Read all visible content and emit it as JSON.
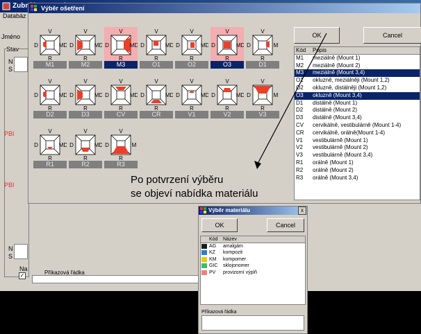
{
  "main_window": {
    "title": "Zubní karta pacienta",
    "menu_first": "Databáz",
    "labels": {
      "name": "Jméno",
      "stav": "Stav",
      "n1": "N",
      "s1": "S",
      "pbi1": "PBI",
      "pbi2": "PBI",
      "n2": "N",
      "s2": "S",
      "na": "Na"
    }
  },
  "treatment_dialog": {
    "title": "Výběr ošetření",
    "ok_label": "OK",
    "cancel_label": "Cancel",
    "list_header": {
      "code": "Kód",
      "description": "Popis"
    },
    "teeth": [
      {
        "code": "M1",
        "selected": false,
        "top": "V",
        "left": "D",
        "right": "MD",
        "bottom": "R",
        "fill": "left-small"
      },
      {
        "code": "M2",
        "selected": false,
        "top": "V",
        "left": "D",
        "right": "MD",
        "bottom": "R",
        "fill": "left"
      },
      {
        "code": "M3",
        "selected": true,
        "top": "V",
        "left": "D",
        "right": "MD",
        "bottom": "R",
        "fill": "right-large"
      },
      {
        "code": "O1",
        "selected": false,
        "top": "V",
        "left": "D",
        "right": "MD",
        "bottom": "R",
        "fill": "center-small"
      },
      {
        "code": "O2",
        "selected": false,
        "top": "V",
        "left": "D",
        "right": "MD",
        "bottom": "R",
        "fill": "center-right"
      },
      {
        "code": "O3",
        "selected": true,
        "top": "V",
        "left": "D",
        "right": "MD",
        "bottom": "R",
        "fill": "center"
      },
      {
        "code": "D1",
        "selected": false,
        "top": "V",
        "left": "D",
        "right": "M",
        "bottom": "R",
        "fill": "right-small"
      },
      {
        "code": "D2",
        "selected": false,
        "top": "V",
        "left": "D",
        "right": "MD",
        "bottom": "R",
        "fill": "left-small"
      },
      {
        "code": "D3",
        "selected": false,
        "top": "V",
        "left": "D",
        "right": "MD",
        "bottom": "R",
        "fill": "left"
      },
      {
        "code": "CV",
        "selected": false,
        "top": "V",
        "left": "D",
        "right": "MD",
        "bottom": "R",
        "fill": "top-small"
      },
      {
        "code": "CR",
        "selected": false,
        "top": "V",
        "left": "D",
        "right": "MD",
        "bottom": "R",
        "fill": "bottom-small"
      },
      {
        "code": "V1",
        "selected": false,
        "top": "V",
        "left": "D",
        "right": "MD",
        "bottom": "R",
        "fill": "top-tiny"
      },
      {
        "code": "V2",
        "selected": false,
        "top": "V",
        "left": "D",
        "right": "MD",
        "bottom": "R",
        "fill": "top"
      },
      {
        "code": "V3",
        "selected": false,
        "top": "V",
        "left": "D",
        "right": "M",
        "bottom": "R",
        "fill": "top-large"
      },
      {
        "code": "R1",
        "selected": false,
        "top": "V",
        "left": "D",
        "right": "MD",
        "bottom": "R",
        "fill": "bottom-tiny"
      },
      {
        "code": "R2",
        "selected": false,
        "top": "V",
        "left": "D",
        "right": "MD",
        "bottom": "R",
        "fill": "bottom"
      },
      {
        "code": "R3",
        "selected": false,
        "top": "V",
        "left": "D",
        "right": "M",
        "bottom": "R",
        "fill": "bottom-large"
      }
    ],
    "list": [
      {
        "code": "M1",
        "description": "meziálně (Mount 1)",
        "selected": false
      },
      {
        "code": "M2",
        "description": "meziálně (Mount 2)",
        "selected": false
      },
      {
        "code": "M3",
        "description": "meziálně (Mount 3,4)",
        "selected": true
      },
      {
        "code": "O1",
        "description": "okluzně, meziálněji (Mount 1,2)",
        "selected": false
      },
      {
        "code": "O2",
        "description": "okluzně, distálněji (Mount 1,2)",
        "selected": false
      },
      {
        "code": "O3",
        "description": "okluzně (Mount 3,4)",
        "selected": true
      },
      {
        "code": "D1",
        "description": "distálně (Mount 1)",
        "selected": false
      },
      {
        "code": "D2",
        "description": "distálně (Mount 2)",
        "selected": false
      },
      {
        "code": "D3",
        "description": "distálně (Mount 3,4)",
        "selected": false
      },
      {
        "code": "CV",
        "description": "cervikálně, vestibulárně (Mount 1-4)",
        "selected": false
      },
      {
        "code": "CR",
        "description": "cervikálně, orálně(Mount 1-4)",
        "selected": false
      },
      {
        "code": "V1",
        "description": "vestibulárně (Mount 1)",
        "selected": false
      },
      {
        "code": "V2",
        "description": "vestibulárně (Mount 2)",
        "selected": false
      },
      {
        "code": "V3",
        "description": "vestibulárně (Mount 3,4)",
        "selected": false
      },
      {
        "code": "R1",
        "description": "orálně (Mount 1)",
        "selected": false
      },
      {
        "code": "R2",
        "description": "orálně (Mount 2)",
        "selected": false
      },
      {
        "code": "R3",
        "description": "orálně (Mount 3,4)",
        "selected": false
      }
    ]
  },
  "annotation": {
    "line1": "Po potvrzení výběru",
    "line2": "se objeví nabídka materiálu"
  },
  "material_dialog": {
    "title": "Výběr materiálu",
    "ok_label": "OK",
    "cancel_label": "Cancel",
    "list_header": {
      "code": "Kód",
      "name": "Název"
    },
    "materials": [
      {
        "code": "AG",
        "name": "amalgám",
        "color": "#1a1a1a"
      },
      {
        "code": "KZ",
        "name": "kompozit",
        "color": "#2a7fd4"
      },
      {
        "code": "KM",
        "name": "kompomer",
        "color": "#e0d000"
      },
      {
        "code": "GIC",
        "name": "sklojonomer",
        "color": "#3cc060"
      },
      {
        "code": "PV",
        "name": "provizorní výplň",
        "color": "#f08080"
      }
    ],
    "command_label": "Příkazová řádka"
  },
  "command_line": {
    "label": "Příkazová řádka"
  },
  "colors": {
    "fill_red": "#e8402a",
    "selected_blue": "#0a246a",
    "selected_pink": "#f2aeb0"
  }
}
